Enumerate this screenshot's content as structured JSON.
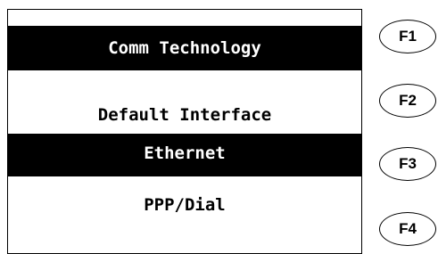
{
  "screen": {
    "title": "Comm Technology",
    "subtitle": "Default Interface",
    "options": [
      {
        "label": "Ethernet",
        "selected": true
      },
      {
        "label": "PPP/Dial",
        "selected": false
      }
    ]
  },
  "function_keys": [
    "F1",
    "F2",
    "F3",
    "F4"
  ]
}
